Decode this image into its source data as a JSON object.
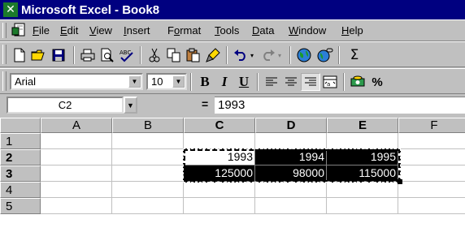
{
  "window": {
    "title": "Microsoft Excel - Book8",
    "icon": "excel-icon"
  },
  "menu": {
    "items": [
      {
        "pre": "",
        "key": "F",
        "post": "ile"
      },
      {
        "pre": "",
        "key": "E",
        "post": "dit"
      },
      {
        "pre": "",
        "key": "V",
        "post": "iew"
      },
      {
        "pre": "",
        "key": "I",
        "post": "nsert"
      },
      {
        "pre": "F",
        "key": "o",
        "post": "rmat"
      },
      {
        "pre": "",
        "key": "T",
        "post": "ools"
      },
      {
        "pre": "",
        "key": "D",
        "post": "ata"
      },
      {
        "pre": "",
        "key": "W",
        "post": "indow"
      },
      {
        "pre": "",
        "key": "H",
        "post": "elp"
      }
    ]
  },
  "standard_toolbar": {
    "icons": [
      "new-icon",
      "open-icon",
      "save-icon",
      "print-icon",
      "print-preview-icon",
      "spelling-icon",
      "cut-icon",
      "copy-icon",
      "paste-icon",
      "format-painter-icon",
      "undo-icon",
      "redo-icon",
      "web-toolbar-icon",
      "hyperlink-icon",
      "autosum-icon"
    ]
  },
  "format_toolbar": {
    "font": "Arial",
    "size": "10",
    "bold": "B",
    "italic": "I",
    "underline": "U",
    "currency": "%"
  },
  "formula_bar": {
    "name_box": "C2",
    "equals": "=",
    "value": "1993"
  },
  "grid": {
    "columns": [
      "A",
      "B",
      "C",
      "D",
      "E",
      "F"
    ],
    "rows": [
      "1",
      "2",
      "3",
      "4",
      "5"
    ],
    "cells": {
      "C2": "1993",
      "D2": "1994",
      "E2": "1995",
      "C3": "125000",
      "D3": "98000",
      "E3": "115000"
    }
  }
}
